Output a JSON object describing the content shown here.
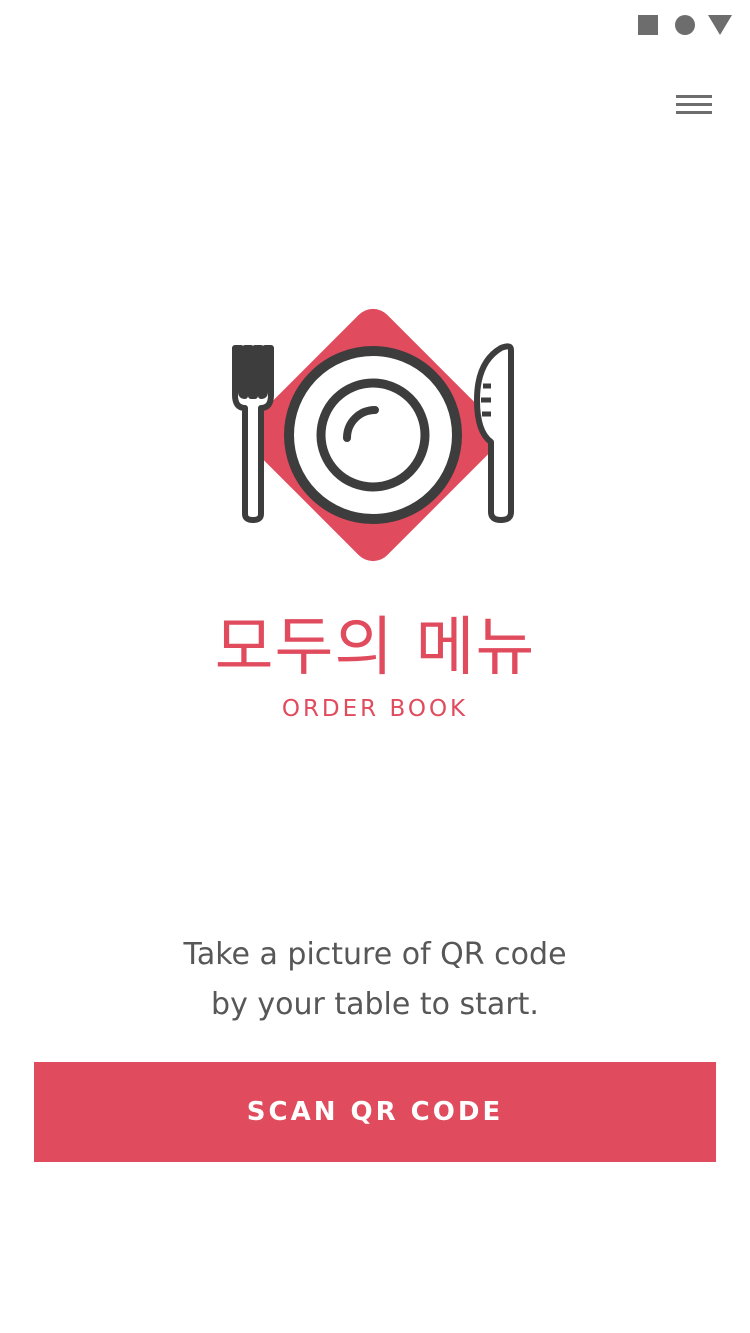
{
  "status_bar": {
    "icons": [
      "square-icon",
      "circle-icon",
      "triangle-icon"
    ]
  },
  "header": {
    "menu_icon": "hamburger-menu-icon"
  },
  "brand": {
    "logo_icon": "plate-fork-knife-icon",
    "title_korean": "모두의 메뉴",
    "title_english": "ORDER BOOK",
    "accent_color": "#e04b5d",
    "logo_dark_color": "#3d3d3d"
  },
  "instruction": {
    "line1": "Take a picture of QR code",
    "line2": "by your table to start."
  },
  "scan_button": {
    "label": "SCAN QR CODE",
    "background_color": "#e04b5d",
    "text_color": "#ffffff"
  }
}
